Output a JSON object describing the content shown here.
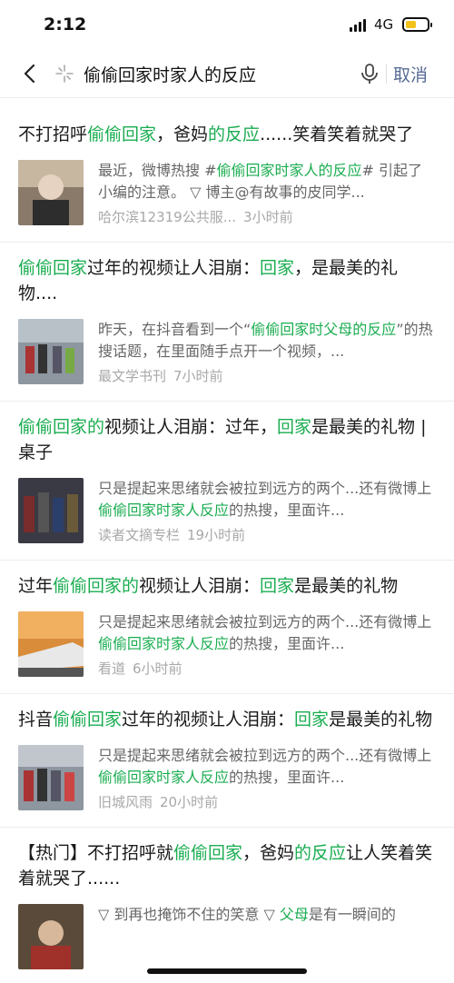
{
  "status_bar": {
    "time": "2:12",
    "network": "4G"
  },
  "search": {
    "query": "偷偷回家时家人的反应",
    "cancel_label": "取消"
  },
  "results": [
    {
      "title": [
        {
          "t": "不打招呼",
          "h": false
        },
        {
          "t": "偷偷回家",
          "h": true
        },
        {
          "t": "，爸妈",
          "h": false
        },
        {
          "t": "的反应",
          "h": true
        },
        {
          "t": "......笑着笑着就哭了",
          "h": false
        }
      ],
      "snippet": [
        {
          "t": "最近，微博热搜 #",
          "h": false
        },
        {
          "t": "偷偷回家时家人的反应",
          "h": true
        },
        {
          "t": "# 引起了小编的注意。 ▽ 博主@有故事的皮同学...",
          "h": false
        }
      ],
      "source": "哈尔滨12319公共服...",
      "time": "3小时前",
      "thumb": "elderly-man-photo"
    },
    {
      "title": [
        {
          "t": "偷偷回家",
          "h": true
        },
        {
          "t": "过年的视频让人泪崩：",
          "h": false
        },
        {
          "t": "回家",
          "h": true
        },
        {
          "t": "，是最美的礼物....",
          "h": false
        }
      ],
      "snippet": [
        {
          "t": "昨天，在抖音看到一个“",
          "h": false
        },
        {
          "t": "偷偷回家时父母的反应",
          "h": true
        },
        {
          "t": "”的热搜话题，在里面随手点开一个视频，...",
          "h": false
        }
      ],
      "source": "最文学书刊",
      "time": "7小时前",
      "thumb": "train-station-photo"
    },
    {
      "title": [
        {
          "t": "偷偷回家的",
          "h": true
        },
        {
          "t": "视频让人泪崩：过年，",
          "h": false
        },
        {
          "t": "回家",
          "h": true
        },
        {
          "t": "是最美的礼物 | 桌子",
          "h": false
        }
      ],
      "snippet": [
        {
          "t": "只是提起来思绪就会被拉到远方的两个...还有微博上",
          "h": false
        },
        {
          "t": "偷偷回家时家人反应",
          "h": true
        },
        {
          "t": "的热搜，里面许...",
          "h": false
        }
      ],
      "source": "读者文摘专栏",
      "time": "19小时前",
      "thumb": "crowd-photo"
    },
    {
      "title": [
        {
          "t": "过年",
          "h": false
        },
        {
          "t": "偷偷回家的",
          "h": true
        },
        {
          "t": "视频让人泪崩：",
          "h": false
        },
        {
          "t": "回家",
          "h": true
        },
        {
          "t": "是最美的礼物",
          "h": false
        }
      ],
      "snippet": [
        {
          "t": "只是提起来思绪就会被拉到远方的两个...还有微博上",
          "h": false
        },
        {
          "t": "偷偷回家时家人反应",
          "h": true
        },
        {
          "t": "的热搜，里面许...",
          "h": false
        }
      ],
      "source": "看道",
      "time": "6小时前",
      "thumb": "high-speed-train-photo"
    },
    {
      "title": [
        {
          "t": "抖音",
          "h": false
        },
        {
          "t": "偷偷回家",
          "h": true
        },
        {
          "t": "过年的视频让人泪崩：",
          "h": false
        },
        {
          "t": "回家",
          "h": true
        },
        {
          "t": "是最美的礼物",
          "h": false
        }
      ],
      "snippet": [
        {
          "t": "只是提起来思绪就会被拉到远方的两个...还有微博上",
          "h": false
        },
        {
          "t": "偷偷回家时家人反应",
          "h": true
        },
        {
          "t": "的热搜，里面许...",
          "h": false
        }
      ],
      "source": "旧城风雨",
      "time": "20小时前",
      "thumb": "train-platform-photo"
    },
    {
      "title": [
        {
          "t": "【热门】不打招呼就",
          "h": false
        },
        {
          "t": "偷偷回家",
          "h": true
        },
        {
          "t": "，爸妈",
          "h": false
        },
        {
          "t": "的反应",
          "h": true
        },
        {
          "t": "让人笑着笑着就哭了......",
          "h": false
        }
      ],
      "snippet": [
        {
          "t": "▽ 到再也掩饰不住的笑意 ▽ ",
          "h": false
        },
        {
          "t": "父母",
          "h": true
        },
        {
          "t": "是有一瞬间的",
          "h": false
        }
      ],
      "source": "",
      "time": "",
      "thumb": "family-photo"
    }
  ],
  "colors": {
    "highlight": "#1aad50",
    "cancel": "#576b95"
  }
}
